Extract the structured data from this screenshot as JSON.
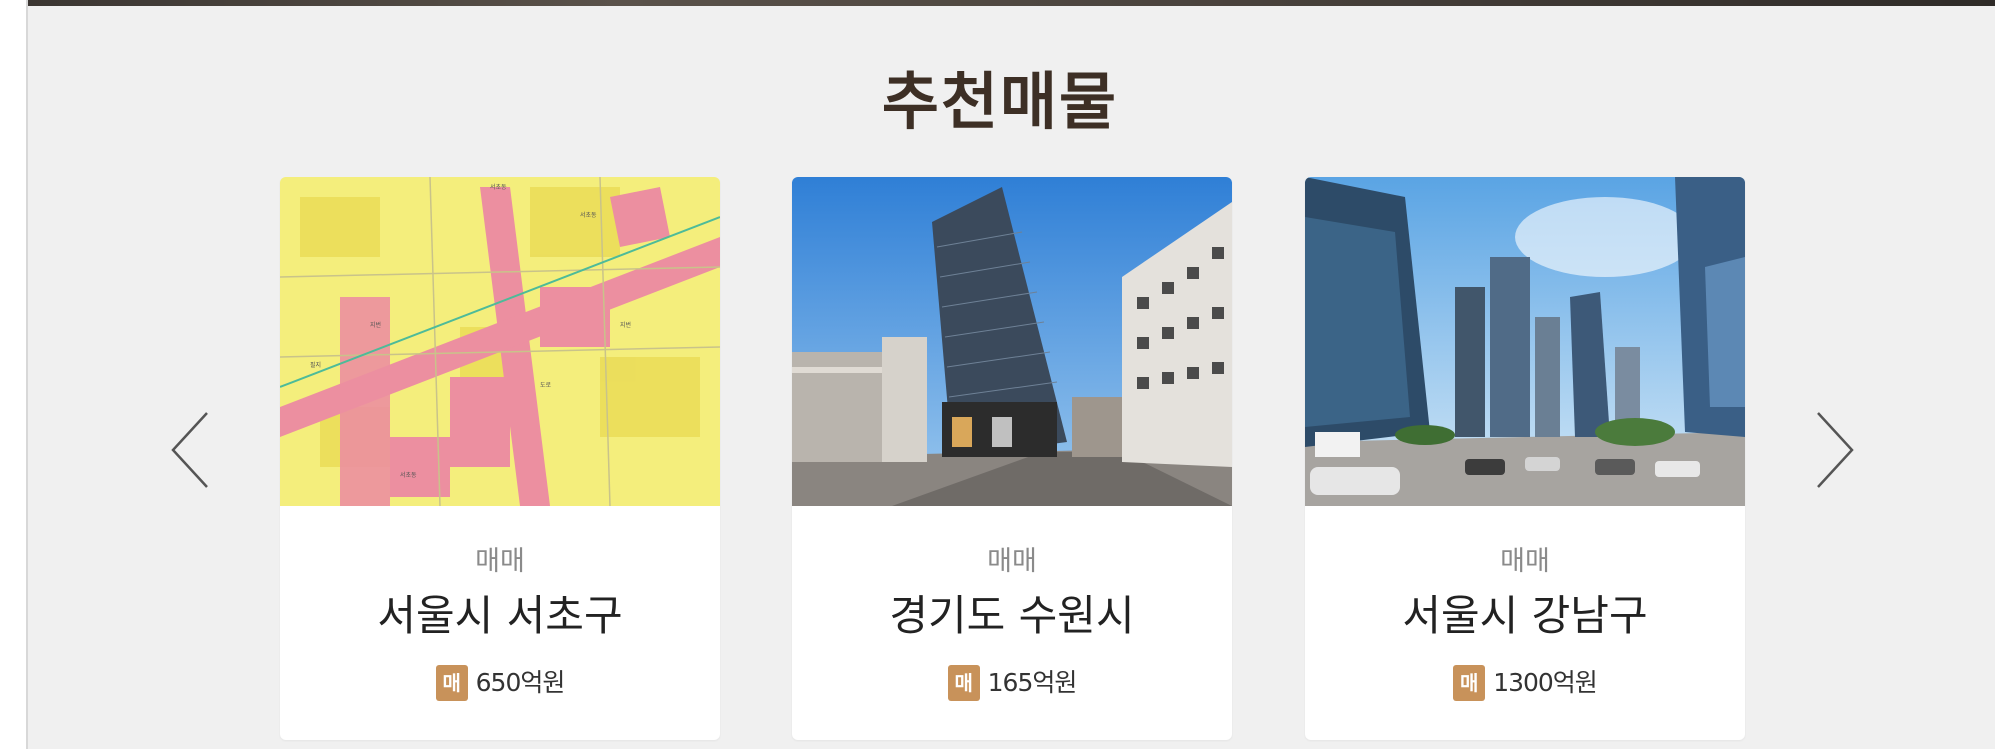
{
  "section": {
    "title": "추천매물"
  },
  "navigation": {
    "prev_icon": "chevron-left-icon",
    "next_icon": "chevron-right-icon"
  },
  "listings": [
    {
      "type": "매매",
      "location": "서울시 서초구",
      "badge": "매",
      "price": "650억원",
      "image": "zoning-map"
    },
    {
      "type": "매매",
      "location": "경기도 수원시",
      "badge": "매",
      "price": "165억원",
      "image": "building-street-photo"
    },
    {
      "type": "매매",
      "location": "서울시 강남구",
      "badge": "매",
      "price": "1300억원",
      "image": "skyscraper-street-photo"
    }
  ],
  "colors": {
    "section_bg": "#f0f0f0",
    "title": "#3d2f25",
    "badge": "#c8925a",
    "card_bg": "#ffffff"
  }
}
